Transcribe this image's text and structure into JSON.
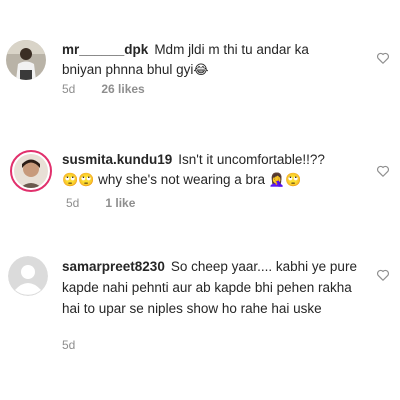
{
  "comments": [
    {
      "username": "mr______dpk",
      "text": "Mdm jldi m thi tu andar ka bniyan phnna bhul gyi",
      "emoji": "😂",
      "time": "5d",
      "likes": "26 likes",
      "avatar": "avatar-photo-icon"
    },
    {
      "username": "susmita.kundu19",
      "text": "Isn't it uncomfortable!!??",
      "line2_emoji_a": "🙄🙄",
      "line2_text": "why she's not wearing a bra",
      "line2_emoji_b": "🤦‍♀️🙄",
      "time": "5d",
      "likes": "1 like",
      "avatar": "avatar-photo-icon",
      "avatar_ring": "#e1306c"
    },
    {
      "username": "samarpreet8230",
      "text": "So cheep yaar.... kabhi ye pure kapde nahi pehnti aur ab kapde bhi pehen rakha hai to upar se niples show ho rahe hai uske",
      "time": "5d",
      "avatar": "default-avatar-icon"
    }
  ],
  "colors": {
    "text": "#262626",
    "muted": "#8e8e8e"
  }
}
